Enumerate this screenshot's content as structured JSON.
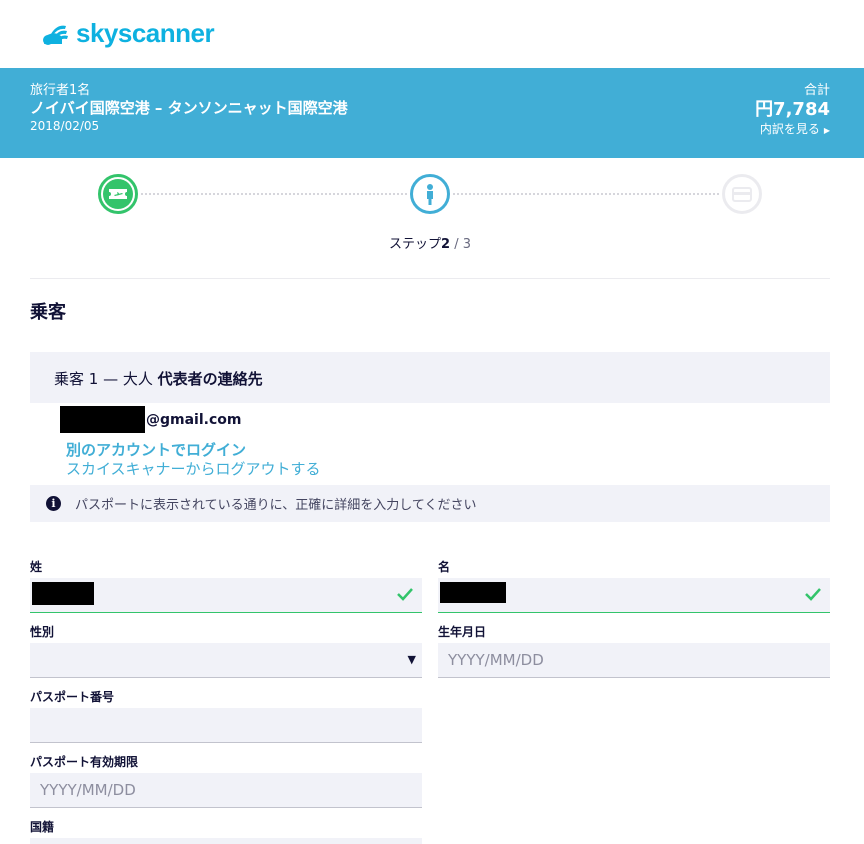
{
  "brand": {
    "name": "skyscanner",
    "color": "#0eb1e0"
  },
  "trip": {
    "travelers": "旅行者1名",
    "route": "ノイバイ国際空港 – タンソンニャット国際空港",
    "date": "2018/02/05",
    "total_label": "合計",
    "total_price": "円7,784",
    "breakdown_link": "内訳を見る",
    "banner_color": "#41aed6"
  },
  "progress": {
    "step_prefix": "ステップ",
    "current": "2",
    "total": " / 3",
    "steps": [
      {
        "icon": "ticket-icon",
        "state": "done"
      },
      {
        "icon": "passenger-icon",
        "state": "active"
      },
      {
        "icon": "credit-card-icon",
        "state": "todo"
      }
    ]
  },
  "section": {
    "title": "乗客"
  },
  "passenger": {
    "header_prefix": "乗客 1 — 大人 ",
    "header_bold": "代表者の連絡先",
    "email_domain": "@gmail.com",
    "login_other": "別のアカウントでログイン",
    "logout": "スカイスキャナーからログアウトする",
    "notice": "パスポートに表示されている通りに、正確に詳細を入力してください"
  },
  "form": {
    "last_name_label": "姓",
    "first_name_label": "名",
    "gender_label": "性別",
    "gender_value": "",
    "dob_label": "生年月日",
    "dob_placeholder": "YYYY/MM/DD",
    "passport_number_label": "パスポート番号",
    "passport_expiry_label": "パスポート有効期限",
    "passport_expiry_placeholder": "YYYY/MM/DD",
    "nationality_label": "国籍"
  }
}
